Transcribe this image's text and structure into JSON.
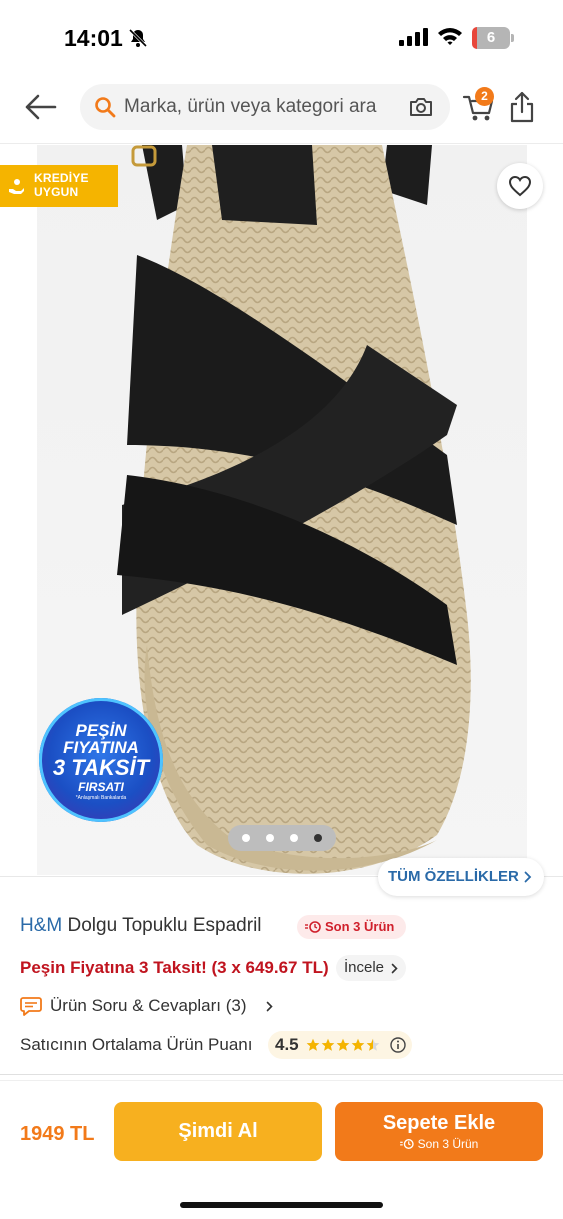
{
  "status_bar": {
    "time": "14:01",
    "battery": "6",
    "battery_level_percent": 6
  },
  "header": {
    "search_placeholder": "Marka, ürün veya kategori ara",
    "cart_count": "2"
  },
  "gallery": {
    "kredi_badge_line1": "KREDİYE",
    "kredi_badge_line2": "UYGUN",
    "promo_line1": "PEŞİN",
    "promo_line2": "FIYATINA",
    "promo_line3": "3 TAKSİT",
    "promo_line4": "FIRSATI",
    "promo_small": "*Anlaşmalı Bankalarda",
    "page_count": 4,
    "active_page": 4,
    "all_specs_label": "TÜM ÖZELLİKLER"
  },
  "product": {
    "brand": "H&M",
    "name": "Dolgu Topuklu Espadril",
    "stock_badge": "Son 3 Ürün",
    "installment_text": "Peşin Fiyatına 3 Taksit! (3 x 649.67 TL)",
    "incele_label": "İncele",
    "qa_label": "Ürün Soru & Cevapları (3)",
    "seller_rating_label": "Satıcının Ortalama Ürün Puanı",
    "seller_rating_value": "4.5"
  },
  "bottom_bar": {
    "price": "1949 TL",
    "buy_now_label": "Şimdi Al",
    "add_to_cart_label": "Sepete Ekle",
    "add_to_cart_sub": "Son 3 Ürün"
  },
  "colors": {
    "brand_orange": "#f27a1a",
    "buy_now_yellow": "#f7b01f",
    "link_blue": "#2a6aa8",
    "alert_red": "#c0141f"
  }
}
